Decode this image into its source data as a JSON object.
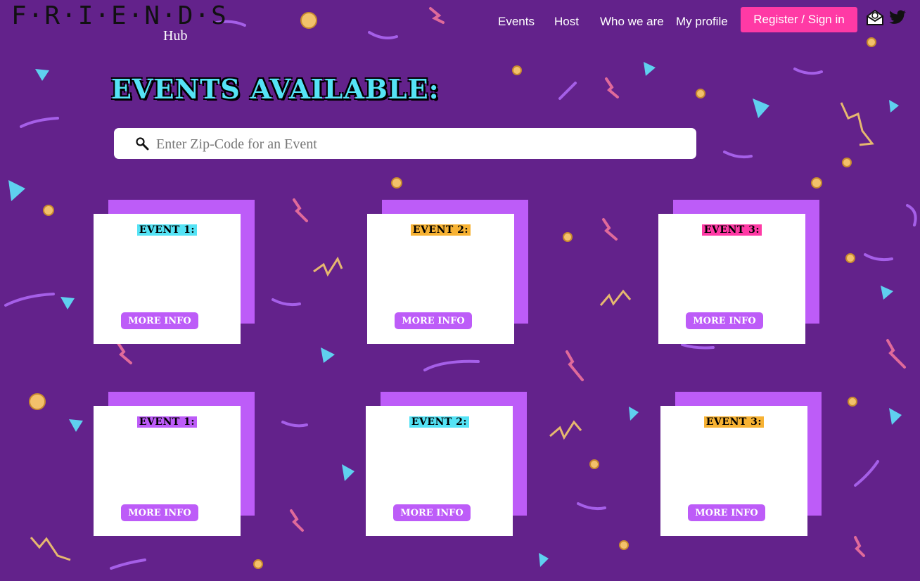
{
  "header": {
    "logo_text": "F·R·I·E·N·D·S",
    "logo_sub": "Hub",
    "nav": [
      "Events",
      "Host",
      "Who we are",
      "My profile"
    ],
    "register_label": "Register / Sign in",
    "icons": [
      "mail-icon",
      "twitter-icon"
    ]
  },
  "main": {
    "title": "Events Available:",
    "search_placeholder": "Enter Zip-Code for an Event",
    "search_value": ""
  },
  "events": [
    {
      "title": "Event 1:",
      "button": "More Info",
      "title_color": "#55e3f5"
    },
    {
      "title": "Event 2:",
      "button": "More Info",
      "title_color": "#f7b233"
    },
    {
      "title": "Event 3:",
      "button": "More Info",
      "title_color": "#ff3aa5"
    },
    {
      "title": "Event 1:",
      "button": "More Info",
      "title_color": "#bd5cf8"
    },
    {
      "title": "Event 2:",
      "button": "More Info",
      "title_color": "#55e3f5"
    },
    {
      "title": "Event 3:",
      "button": "More Info",
      "title_color": "#f7b233"
    }
  ],
  "colors": {
    "background": "#63228b",
    "accent_pink": "#ff3aa5",
    "accent_purple": "#bd5cf8",
    "accent_cyan": "#55e3f5",
    "accent_orange": "#f7b233"
  }
}
